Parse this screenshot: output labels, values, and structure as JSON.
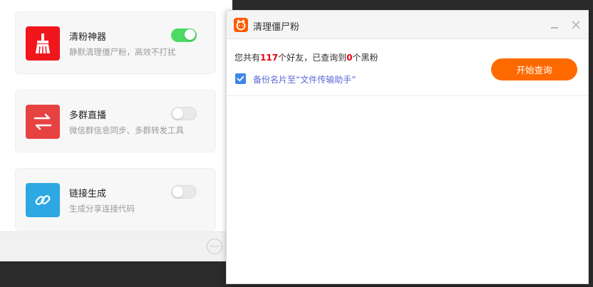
{
  "cards": [
    {
      "title": "清粉神器",
      "desc": "静默清理僵尸粉，高效不打扰",
      "toggle_on": true,
      "color": "#f0161c",
      "icon": "broom-icon"
    },
    {
      "title": "多群直播",
      "desc": "微信群信息同步、多群转发工具",
      "toggle_on": false,
      "color": "#e74242",
      "icon": "swap-arrows-icon"
    },
    {
      "title": "链接生成",
      "desc": "生成分享连接代码",
      "toggle_on": false,
      "color": "#2ea8e3",
      "icon": "link-icon"
    }
  ],
  "dialog": {
    "title": "清理僵尸粉",
    "summary": {
      "prefix": "您共有",
      "friend_count": "117",
      "middle": "个好友，已查询到",
      "black_count": "0",
      "suffix": "个黑粉"
    },
    "backup_label": "备份名片至“文件传输助手”",
    "backup_checked": true,
    "start_button": "开始查询",
    "accent_color": "#ff6a00"
  }
}
